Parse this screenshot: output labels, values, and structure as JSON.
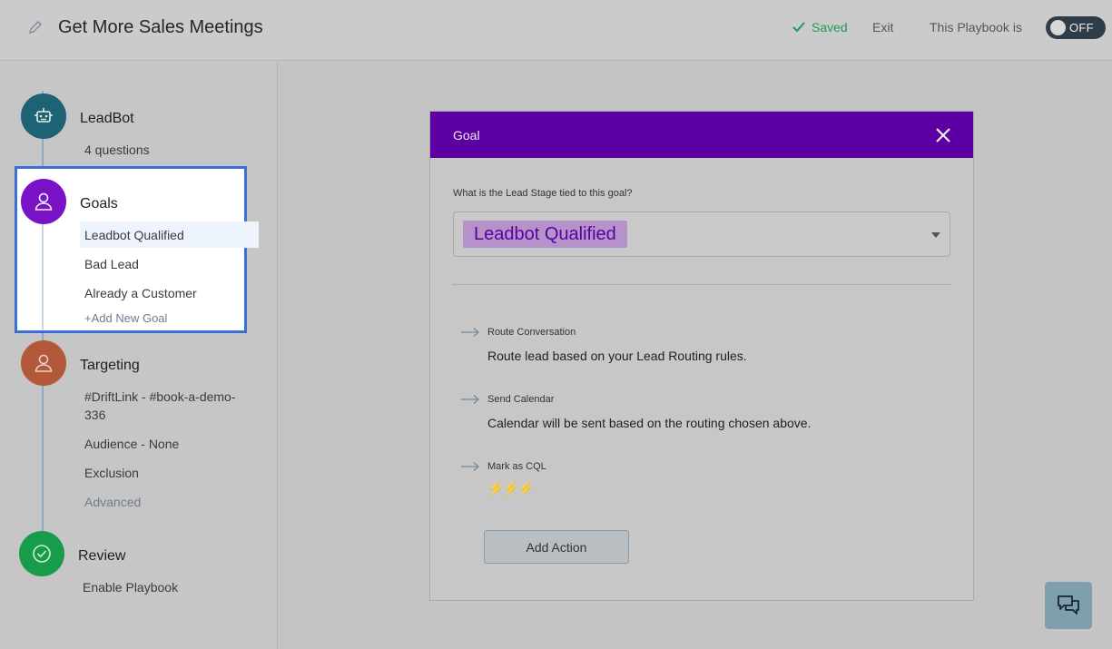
{
  "header": {
    "title": "Get More Sales Meetings",
    "saved_label": "Saved",
    "exit_label": "Exit",
    "playbook_status_label": "This Playbook is",
    "toggle_label": "OFF"
  },
  "sidebar": {
    "steps": [
      {
        "title": "LeadBot",
        "subtitle": "4 questions"
      },
      {
        "title": "Goals",
        "items": [
          "Leadbot Qualified",
          "Bad Lead",
          "Already a Customer"
        ],
        "add_label": "+Add New Goal"
      },
      {
        "title": "Targeting",
        "items": [
          "#DriftLink - #book-a-demo-",
          "336",
          "Audience - None",
          "Exclusion"
        ],
        "advanced_label": "Advanced"
      },
      {
        "title": "Review",
        "subtitle": "Enable Playbook"
      }
    ]
  },
  "modal": {
    "title": "Goal",
    "question": "What is the Lead Stage tied to this goal?",
    "selected_stage": "Leadbot Qualified",
    "actions": [
      {
        "label": "Route Conversation",
        "description": "Route lead based on your Lead Routing rules."
      },
      {
        "label": "Send Calendar",
        "description": "Calendar will be sent based on the routing chosen above."
      },
      {
        "label": "Mark as CQL",
        "description": "⚡⚡⚡"
      }
    ],
    "add_action_label": "Add Action"
  },
  "colors": {
    "accent_purple": "#5c00a3",
    "highlight_blue": "#3b6fd6",
    "saved_green": "#1f9a56"
  }
}
